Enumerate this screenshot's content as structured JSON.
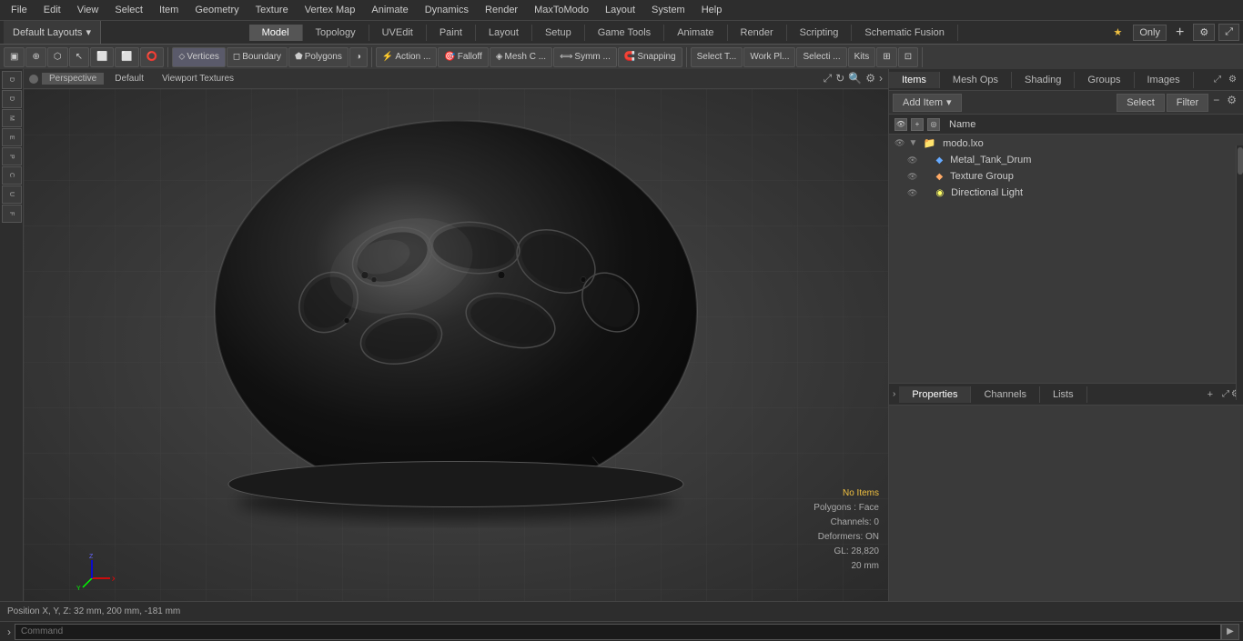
{
  "menuBar": {
    "items": [
      "File",
      "Edit",
      "View",
      "Select",
      "Item",
      "Geometry",
      "Texture",
      "Vertex Map",
      "Animate",
      "Dynamics",
      "Render",
      "MaxToModo",
      "Layout",
      "System",
      "Help"
    ]
  },
  "layoutBar": {
    "dropdown": "Default Layouts",
    "tabs": [
      "Model",
      "Topology",
      "UVEdit",
      "Paint",
      "Layout",
      "Setup",
      "Game Tools",
      "Animate",
      "Render",
      "Scripting",
      "Schematic Fusion"
    ],
    "activeTab": "Model",
    "rightLabel": "Only",
    "plusBtn": "+"
  },
  "toolBar": {
    "modeButtons": [
      "▣",
      "⊕",
      "⬡",
      "↖",
      "⬜",
      "⬜",
      "⭕",
      "◑"
    ],
    "selectionModes": [
      "Vertices",
      "Boundary",
      "Polygons"
    ],
    "tools": [
      "Action ...",
      "Falloff",
      "Mesh C ...",
      "Symm ...",
      "Snapping",
      "Select T...",
      "Work Pl...",
      "Selecti ...",
      "Kits"
    ],
    "verticesLabel": "Vertices",
    "boundaryLabel": "Boundary",
    "polygonsLabel": "Polygons",
    "actionLabel": "Action ...",
    "falloffLabel": "Falloff",
    "meshLabel": "Mesh C ...",
    "symmLabel": "Symm ...",
    "snappingLabel": "Snapping",
    "selectTLabel": "Select T...",
    "workPlLabel": "Work Pl...",
    "selectiLabel": "Selecti ...",
    "kitsLabel": "Kits"
  },
  "viewport": {
    "perspective": "Perspective",
    "default": "Default",
    "viewportTextures": "Viewport Textures"
  },
  "sceneInfo": {
    "noItems": "No Items",
    "polygons": "Polygons : Face",
    "channels": "Channels: 0",
    "deformers": "Deformers: ON",
    "gl": "GL: 28,820",
    "zoom": "20 mm"
  },
  "statusBar": {
    "position": "Position X, Y, Z:  32 mm, 200 mm, -181 mm"
  },
  "commandBar": {
    "placeholder": "Command"
  },
  "rightPanel": {
    "tabs": [
      "Items",
      "Mesh Ops",
      "Shading",
      "Groups",
      "Images"
    ],
    "activeTab": "Items",
    "addItemLabel": "Add Item",
    "selectLabel": "Select",
    "filterLabel": "Filter",
    "columnHeader": "Name",
    "sceneItems": [
      {
        "id": "modo-lxo",
        "label": "modo.lxo",
        "level": 0,
        "icon": "📁",
        "type": "root"
      },
      {
        "id": "metal-tank-drum",
        "label": "Metal_Tank_Drum",
        "level": 1,
        "icon": "🔷",
        "type": "mesh"
      },
      {
        "id": "texture-group",
        "label": "Texture Group",
        "level": 1,
        "icon": "🔶",
        "type": "texture"
      },
      {
        "id": "directional-light",
        "label": "Directional Light",
        "level": 1,
        "icon": "💡",
        "type": "light"
      }
    ]
  },
  "propertiesPanel": {
    "tabs": [
      "Properties",
      "Channels",
      "Lists"
    ],
    "activeTab": "Properties",
    "plusBtn": "+"
  },
  "sidebarItems": [
    "D",
    "D",
    "M",
    "E",
    "P",
    "C",
    "U",
    "F"
  ]
}
